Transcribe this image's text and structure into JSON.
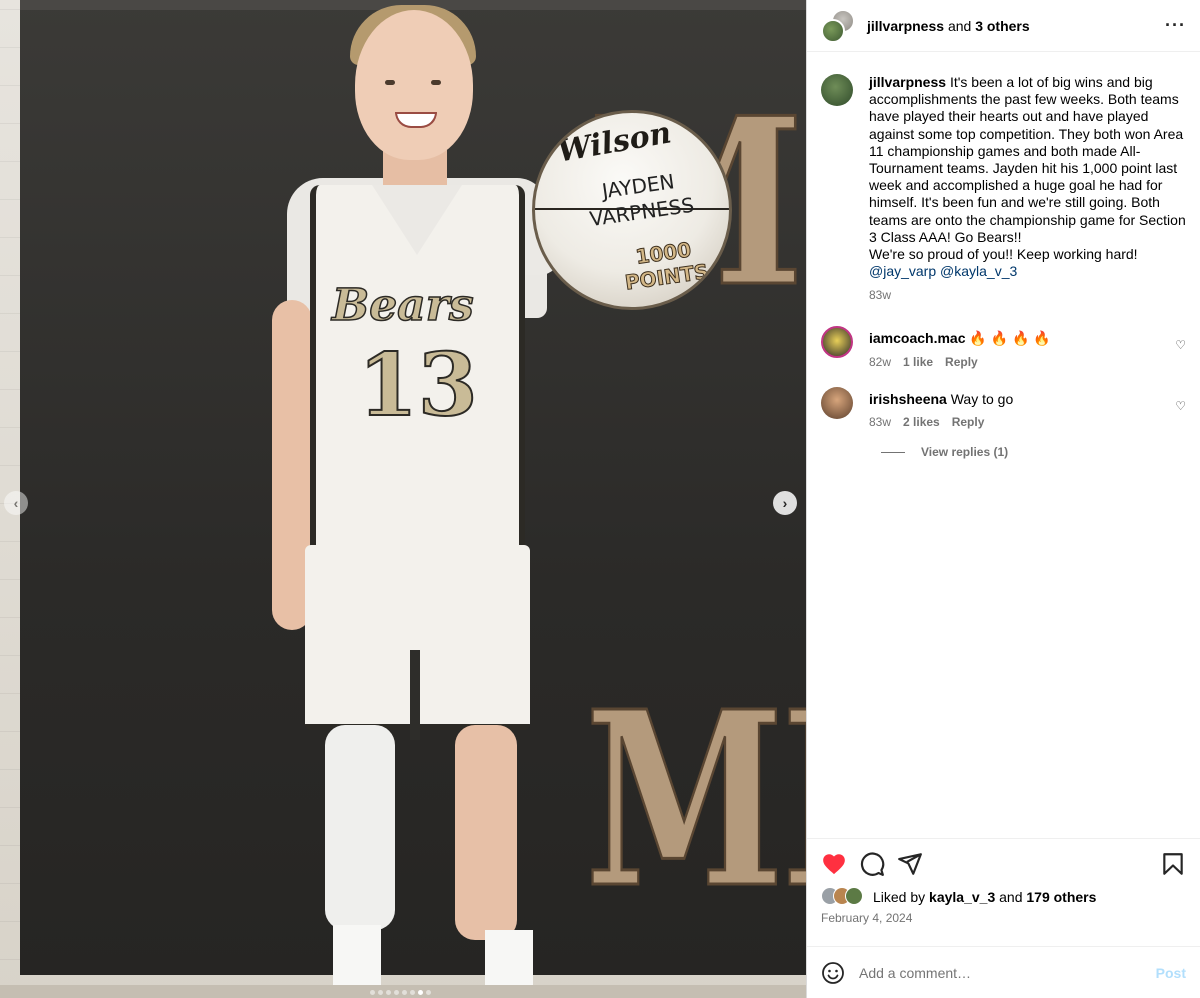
{
  "photo": {
    "ball_brand": "Wilson",
    "ball_name_line1": "JAYDEN",
    "ball_name_line2": "VARPNESS",
    "ball_points_line1": "1000",
    "ball_points_line2": "POINTS",
    "jersey_word": "Bears",
    "jersey_number": "13",
    "banner_top": "MIC",
    "banner_bottom": "MID",
    "carousel_dots": 8,
    "carousel_active_index": 6
  },
  "header": {
    "author": "jillvarpness",
    "joiner": "and",
    "others": "3 others"
  },
  "caption": {
    "username": "jillvarpness",
    "text": "It's been a lot of big wins and big accomplishments the past few weeks. Both teams have played their hearts out and have played against some top competition. They both won Area 11 championship games and both made All-Tournament teams. Jayden hit his 1,000 point last week and accomplished a huge goal he had for himself. It's been fun and we're still going. Both teams are onto the championship game for Section 3 Class AAA! Go Bears!!",
    "text2": "We're so proud of you!! Keep working hard!",
    "mention1": "@jay_varp",
    "mention2": "@kayla_v_3",
    "age": "83w"
  },
  "comments": [
    {
      "username": "iamcoach.mac",
      "text": "🔥 🔥 🔥 🔥",
      "age": "82w",
      "likes": "1 like",
      "reply": "Reply"
    },
    {
      "username": "irishsheena",
      "text": "Way to go",
      "age": "83w",
      "likes": "2 likes",
      "reply": "Reply"
    }
  ],
  "view_replies": "View replies (1)",
  "likes": {
    "prefix": "Liked by",
    "user": "kayla_v_3",
    "joiner": "and",
    "others": "179 others"
  },
  "date": "February 4, 2024",
  "add_comment": {
    "placeholder": "Add a comment…",
    "post_label": "Post"
  },
  "colors": {
    "like_red": "#ff3040",
    "link_blue": "#00376b",
    "post_disabled": "#b2dffc",
    "muted": "#737373"
  }
}
